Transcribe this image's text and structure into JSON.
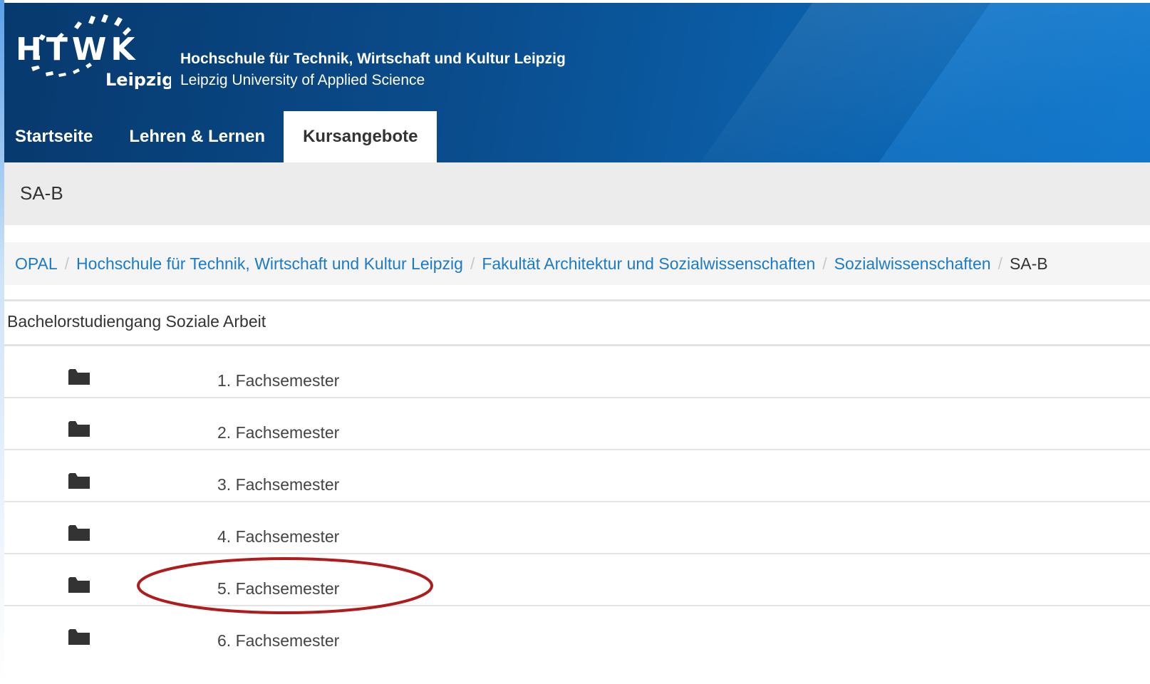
{
  "header": {
    "logo_text": "HTWK",
    "logo_city": "Leipzig",
    "name_de": "Hochschule für Technik, Wirtschaft und Kultur Leipzig",
    "name_en": "Leipzig University of Applied Science"
  },
  "nav": {
    "items": [
      {
        "label": "Startseite"
      },
      {
        "label": "Lehren & Lernen"
      },
      {
        "label": "Kursangebote"
      }
    ],
    "active": "Kursangebote"
  },
  "course": {
    "title": "SA-B"
  },
  "breadcrumb": {
    "items": [
      {
        "label": "OPAL"
      },
      {
        "label": "Hochschule für Technik, Wirtschaft und Kultur Leipzig"
      },
      {
        "label": "Fakultät Architektur und Sozialwissenschaften"
      },
      {
        "label": "Sozialwissenschaften"
      }
    ],
    "separator": "/",
    "current": "SA-B"
  },
  "description": "Bachelorstudiengang Soziale Arbeit",
  "folders": [
    {
      "label": "1. Fachsemester",
      "icon": "folder-icon"
    },
    {
      "label": "2. Fachsemester",
      "icon": "folder-icon"
    },
    {
      "label": "3. Fachsemester",
      "icon": "folder-icon"
    },
    {
      "label": "4. Fachsemester",
      "icon": "folder-icon"
    },
    {
      "label": "5. Fachsemester",
      "icon": "folder-icon"
    },
    {
      "label": "6. Fachsemester",
      "icon": "folder-icon"
    }
  ],
  "colors": {
    "header_dark": "#07396d",
    "header_light": "#0d73c6",
    "link": "#1c7bc6",
    "highlight_ring": "#b01c1c"
  }
}
